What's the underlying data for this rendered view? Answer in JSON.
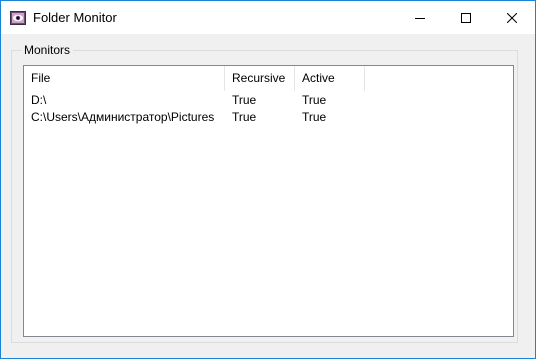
{
  "window": {
    "title": "Folder Monitor",
    "accent_color": "#1883d7",
    "icon": "app-eye-icon",
    "controls": {
      "minimize_icon": "minimize-icon",
      "maximize_icon": "maximize-icon",
      "close_icon": "close-icon"
    }
  },
  "monitors": {
    "group_label": "Monitors",
    "columns": [
      "File",
      "Recursive",
      "Active"
    ],
    "rows": [
      {
        "file": "D:\\",
        "recursive": "True",
        "active": "True"
      },
      {
        "file": "C:\\Users\\Администратор\\Pictures",
        "recursive": "True",
        "active": "True"
      }
    ]
  }
}
